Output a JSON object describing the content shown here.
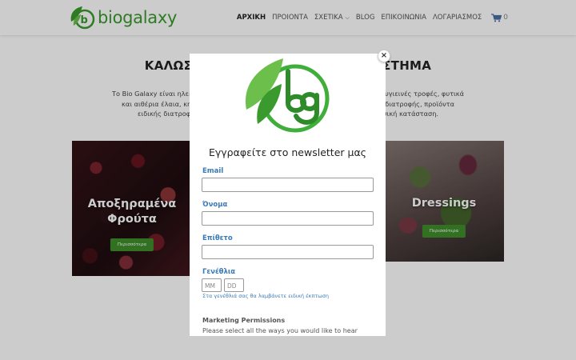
{
  "header": {
    "logo_text": "biogalaxy",
    "nav": [
      {
        "label": "ΑΡΧΙΚΗ",
        "active": true
      },
      {
        "label": "ΠΡΟΙΟΝΤΑ"
      },
      {
        "label": "ΣΧΕΤΙΚΑ"
      },
      {
        "label": "BLOG"
      },
      {
        "label": "ΕΠΙΚΟΙΝΩΝΙΑ"
      },
      {
        "label": "ΛΟΓΑΡΙΑΣΜΟΣ"
      }
    ],
    "cart_count": "0"
  },
  "main": {
    "headline_left": "ΚΑΛΩΣ",
    "headline_right": "ΣΤΗΜΑ",
    "intro_lines": [
      "Το Bio Galaxy είναι ηλεκτ",
      "και αιθέρια έλαια, κηρ",
      "ειδικής διατροφή",
      ", υγιεινές τροφές, φυτικά",
      "α διατροφής, προϊόντα",
      "φυσική κατάσταση."
    ],
    "cards": [
      {
        "title_line1": "Αποξηραμένα",
        "title_line2": "Φρούτα",
        "button": "Περισσότερα"
      },
      {
        "title_line1": "Dressings",
        "button": "Περισσότερα"
      }
    ]
  },
  "modal": {
    "close_label": "×",
    "title": "Εγγραφείτε στο newsletter μας",
    "fields": {
      "email_label": "Email",
      "name_label": "Όνομα",
      "surname_label": "Επίθετο",
      "birthday_label": "Γενέθλια",
      "month_placeholder": "MM",
      "day_placeholder": "DD",
      "birthday_hint": "Στα γενέθλιά σας θα λαμβάνετε ειδική έκπτωση"
    },
    "marketing": {
      "title": "Marketing Permissions",
      "text": "Please select all the ways you would like to hear"
    }
  },
  "colors": {
    "brand_green": "#3a9a2e",
    "link_blue": "#3a7ab8",
    "button_green": "#3e8e2a"
  }
}
